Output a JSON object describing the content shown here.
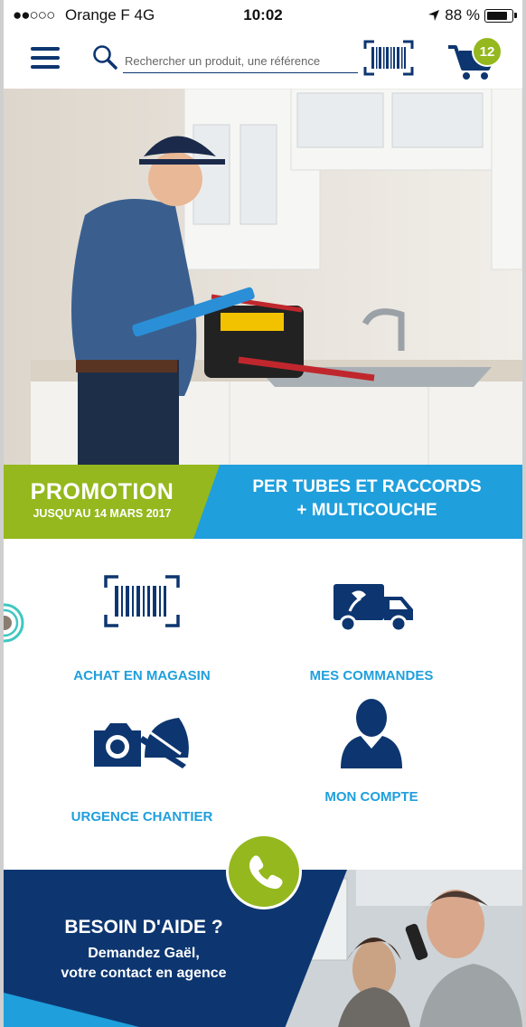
{
  "status_bar": {
    "signal": "●●○○○",
    "carrier": "Orange F  4G",
    "time": "10:02",
    "battery": "88 %",
    "battery_level": 0.88
  },
  "header": {
    "search_placeholder": "Rechercher un produit, une référence",
    "cart_count": "12",
    "icons": [
      "menu-icon",
      "search-icon",
      "barcode-scan-icon",
      "cart-icon"
    ]
  },
  "promo": {
    "title": "PROMOTION",
    "subtitle": "JUSQU'AU 14 MARS 2017",
    "text_line1": "PER TUBES ET RACCORDS",
    "text_line2": "+ MULTICOUCHE"
  },
  "tiles": [
    {
      "label": "ACHAT EN MAGASIN",
      "icon": "barcode-icon"
    },
    {
      "label": "MES COMMANDES",
      "icon": "delivery-truck-icon"
    },
    {
      "label": "URGENCE CHANTIER",
      "icon": "camera-helmet-icon"
    },
    {
      "label": "MON COMPTE",
      "icon": "user-icon"
    }
  ],
  "help": {
    "title": "BESOIN D'AIDE ?",
    "line1": "Demandez Gaël,",
    "line2": "votre contact en agence"
  },
  "colors": {
    "navy": "#0d3670",
    "blue": "#1f9fdc",
    "green": "#94b81e"
  }
}
